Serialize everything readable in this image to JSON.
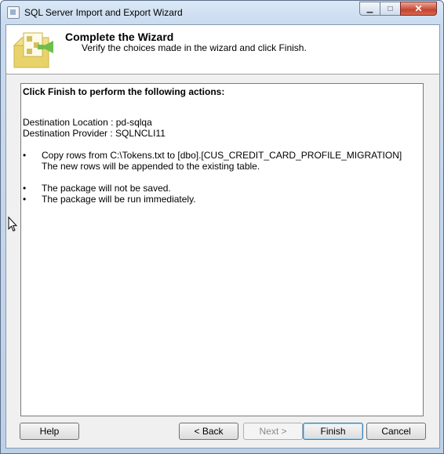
{
  "window": {
    "title": "SQL Server Import and Export Wizard",
    "controls": {
      "minimize": "▁",
      "maximize": "□",
      "close": "✕"
    }
  },
  "header": {
    "title": "Complete the Wizard",
    "subtitle": "Verify the choices made in the wizard and click Finish."
  },
  "summary": {
    "heading": "Click Finish to perform the following actions:",
    "destination_location": "Destination Location : pd-sqlqa",
    "destination_provider": "Destination Provider : SQLNCLI11",
    "bullet_char": "•",
    "copy_action": "Copy rows from C:\\Tokens.txt to [dbo].[CUS_CREDIT_CARD_PROFILE_MIGRATION]",
    "copy_note": "The new rows will be appended to the existing table.",
    "save_note": "The package will not be saved.",
    "run_note": "The package will be run immediately."
  },
  "buttons": {
    "help": "Help",
    "back": "< Back",
    "next": "Next >",
    "finish": "Finish",
    "cancel": "Cancel"
  },
  "colors": {
    "title_bar": "#c9dbef",
    "close_button": "#c6452f",
    "dialog_background": "#f0f0f0",
    "logo_yellow": "#e8d36a",
    "logo_green": "#6cc04a"
  },
  "icons": {
    "app": "wizard-app-icon",
    "logo": "wizard-logo-icon",
    "cursor": "mouse-pointer-icon"
  }
}
